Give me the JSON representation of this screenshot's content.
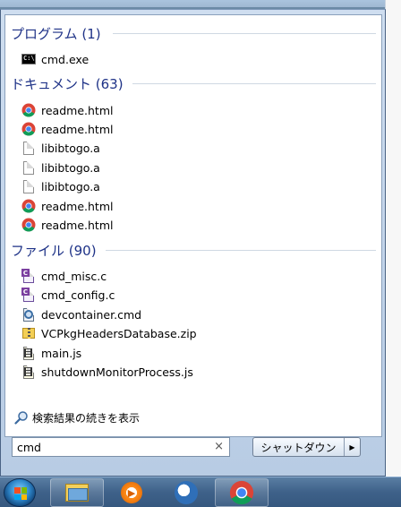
{
  "search": {
    "query": "cmd",
    "clear_symbol": "×",
    "search_more_label": "検索結果の続きを表示"
  },
  "groups": [
    {
      "header": "プログラム (1)",
      "items": [
        {
          "label": "cmd.exe",
          "icon": "cmd-icon"
        }
      ]
    },
    {
      "header": "ドキュメント (63)",
      "items": [
        {
          "label": "readme.html",
          "icon": "chrome-icon"
        },
        {
          "label": "readme.html",
          "icon": "chrome-icon"
        },
        {
          "label": "libibtogo.a",
          "icon": "file-icon"
        },
        {
          "label": "libibtogo.a",
          "icon": "file-icon"
        },
        {
          "label": "libibtogo.a",
          "icon": "file-icon"
        },
        {
          "label": "readme.html",
          "icon": "chrome-icon"
        },
        {
          "label": "readme.html",
          "icon": "chrome-icon"
        }
      ]
    },
    {
      "header": "ファイル (90)",
      "items": [
        {
          "label": "cmd_misc.c",
          "icon": "c-source-icon"
        },
        {
          "label": "cmd_config.c",
          "icon": "c-source-icon"
        },
        {
          "label": "devcontainer.cmd",
          "icon": "config-file-icon"
        },
        {
          "label": "VCPkgHeadersDatabase.zip",
          "icon": "zip-folder-icon"
        },
        {
          "label": "main.js",
          "icon": "script-icon"
        },
        {
          "label": "shutdownMonitorProcess.js",
          "icon": "script-icon"
        }
      ]
    }
  ],
  "shutdown": {
    "label": "シャットダウン",
    "arrow": "▶"
  },
  "colors": {
    "group_header": "#1e3287",
    "menu_bg": "#cfdef0",
    "taskbar": "#3e6189"
  }
}
